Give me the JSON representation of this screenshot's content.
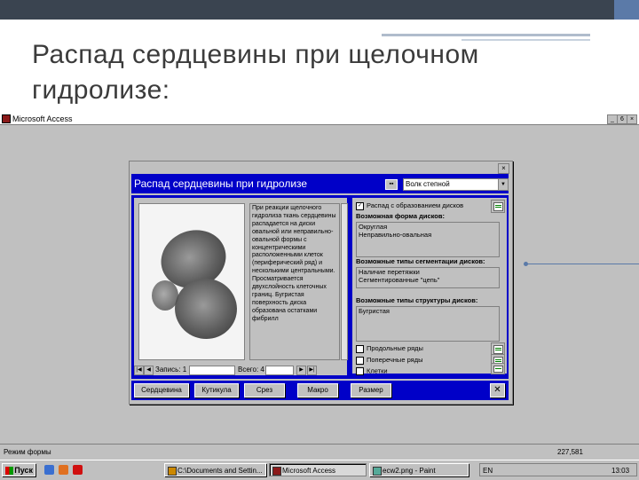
{
  "slide": {
    "title_line1": "Распад сердцевины при щелочном",
    "title_line2": "гидролизе:"
  },
  "app": {
    "title": "Microsoft Access",
    "controls": [
      "_",
      "6",
      "×"
    ]
  },
  "form": {
    "title": "Распад сердцевины при гидролизе",
    "combo_value": "Волк степной",
    "description": "При реакции щелочного гидролиза ткань сердцевины распадается на диски овальной или неправильно-овальной формы с концентрическими расположенными клеток (периферический ряд) и несколькими центральными. Просматривается двухслойность клеточных границ. Бугристая поверхность диска образована остатками фибрилл",
    "nav": {
      "record_label": "Запись: 1",
      "total_label": "Всего: 4"
    },
    "right": {
      "check1_label": "Распад с образованием дисков",
      "shape_label": "Возможная форма дисков:",
      "shape_values": [
        "Округлая",
        "Неправильно-овальная"
      ],
      "segment_label": "Возможные типы сегментации дисков:",
      "segment_values": [
        "Наличие перетяжки",
        "Сегментированные \"цепь\""
      ],
      "structure_label": "Возможные типы структуры дисков:",
      "structure_values": [
        "Бугристая"
      ],
      "options": [
        "Продольные ряды",
        "Поперечные ряды",
        "Клетки"
      ]
    },
    "buttons": [
      "Сердцевина",
      "Кутикула",
      "Срез",
      "Макро",
      "Размер"
    ]
  },
  "status": {
    "left": "Режим формы",
    "right": "227,581"
  },
  "taskbar": {
    "start": "Пуск",
    "tasks": [
      "C:\\Documents and Settin...",
      "Microsoft Access",
      "ecw2.png - Paint"
    ],
    "lang": "EN",
    "clock": "13:03"
  }
}
